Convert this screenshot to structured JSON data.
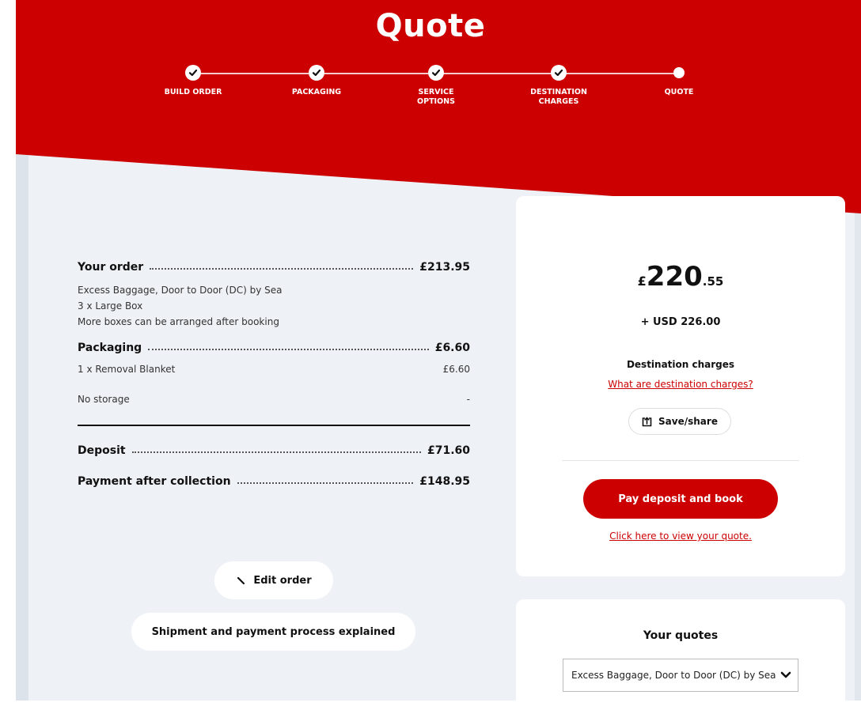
{
  "header": {
    "title": "Quote",
    "steps": [
      {
        "label_lines": [
          "BUILD ORDER"
        ],
        "state": "done"
      },
      {
        "label_lines": [
          "PACKAGING"
        ],
        "state": "done"
      },
      {
        "label_lines": [
          "SERVICE",
          "OPTIONS"
        ],
        "state": "done"
      },
      {
        "label_lines": [
          "DESTINATION",
          "CHARGES"
        ],
        "state": "done"
      },
      {
        "label_lines": [
          "QUOTE"
        ],
        "state": "current"
      }
    ]
  },
  "summary": {
    "order": {
      "label": "Your order",
      "amount": "£213.95",
      "details": [
        "Excess Baggage, Door to Door (DC) by Sea",
        "3 x Large Box",
        "More boxes can be arranged after booking"
      ]
    },
    "packaging": {
      "label": "Packaging",
      "amount": "£6.60",
      "item": "1 x Removal Blanket",
      "item_amount": "£6.60"
    },
    "storage": {
      "label": "No storage",
      "amount": "-"
    },
    "deposit": {
      "label": "Deposit",
      "amount": "£71.60"
    },
    "after_collection": {
      "label": "Payment after collection",
      "amount": "£148.95"
    },
    "edit_label": "Edit order",
    "process_label": "Shipment and payment process explained"
  },
  "price_card": {
    "currency": "£",
    "major": "220",
    "minor": ".55",
    "usd": "+ USD 226.00",
    "destination_label": "Destination charges",
    "destination_link": "What are destination charges?",
    "save_label": "Save/share",
    "pay_label": "Pay deposit and book",
    "view_link": "Click here to view your quote."
  },
  "quotes": {
    "title": "Your quotes",
    "selected": "Excess Baggage, Door to Door (DC) by Sea"
  },
  "colors": {
    "brand_red": "#cc0000",
    "page_bg": "#eef2f6"
  },
  "icons": {
    "step_done": "check-icon",
    "edit": "pencil-icon",
    "share": "share-icon",
    "dropdown": "chevron-down-icon"
  }
}
